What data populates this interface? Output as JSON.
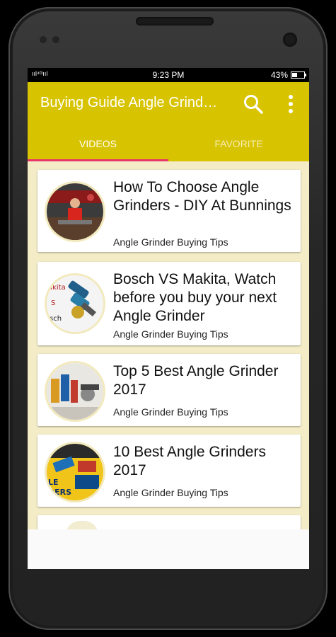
{
  "status": {
    "signal": "…ıl 4G ııl",
    "time": "9:23 PM",
    "battery": "43%",
    "battery_level": 0.43
  },
  "appbar": {
    "title": "Buying Guide Angle Grind…",
    "color": "#d8c300"
  },
  "tabs": [
    {
      "label": "VIDEOS",
      "active": true
    },
    {
      "label": "FAVORITE",
      "active": false
    }
  ],
  "videos": [
    {
      "title": "How To Choose Angle Grinders - DIY At Bunnings",
      "subtitle": "Angle Grinder Buying Tips"
    },
    {
      "title": "Bosch VS Makita, Watch before you buy your next Angle Grinder",
      "subtitle": "Angle Grinder Buying Tips",
      "thumb_text": "akita\nS\nsch"
    },
    {
      "title": "Top 5 Best Angle Grinder 2017",
      "subtitle": "Angle Grinder Buying Tips"
    },
    {
      "title": "10 Best Angle Grinders 2017",
      "subtitle": "Angle Grinder Buying Tips",
      "thumb_text": "LE\nDERS"
    }
  ]
}
